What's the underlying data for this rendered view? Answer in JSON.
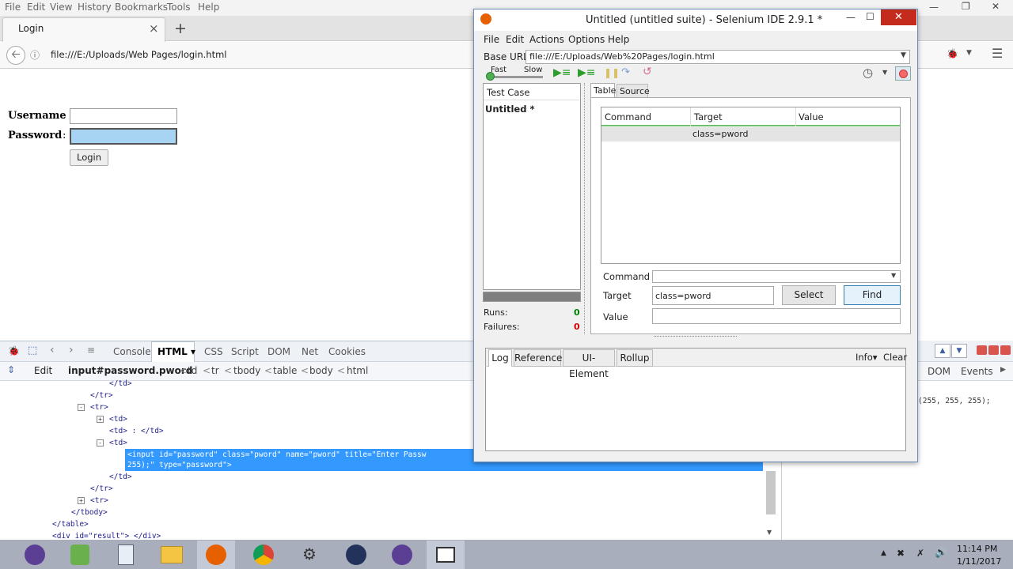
{
  "browser": {
    "menu": [
      "File",
      "Edit",
      "View",
      "History",
      "Bookmarks",
      "Tools",
      "Help"
    ],
    "tab_title": "Login",
    "tab_close": "×",
    "new_tab": "+",
    "url": "file:///E:/Uploads/Web Pages/login.html"
  },
  "page": {
    "username_label": "Username",
    "password_label": "Password",
    "colon": ":",
    "login_button": "Login"
  },
  "firebug": {
    "tabs": [
      "Console",
      "HTML ▾",
      "CSS",
      "Script",
      "DOM",
      "Net",
      "Cookies"
    ],
    "edit_label": "Edit",
    "breadcrumb_current": "input#password.pword",
    "breadcrumbs": [
      "td",
      "tr",
      "tbody",
      "table",
      "body",
      "html"
    ],
    "side_tabs": [
      "DOM",
      "Events"
    ],
    "side_style_text": "(255, 255, 255);",
    "code_lines": [
      "</td>",
      "</tr>",
      "<tr>",
      "<td>",
      "<td> : </td>",
      "<td>",
      "<input id=\"password\" class=\"pword\" name=\"pword\" title=\"Enter Passw",
      "255);\" type=\"password\">",
      "</td>",
      "</tr>",
      "<tr>",
      "</tbody>",
      "</table>",
      "<div id=\"result\"> </div>"
    ]
  },
  "selenium": {
    "window_title": "Untitled (untitled suite) - Selenium IDE 2.9.1 *",
    "menu": [
      "File",
      "Edit",
      "Actions",
      "Options",
      "Help"
    ],
    "base_url_label": "Base URL",
    "base_url": "file:///E:/Uploads/Web%20Pages/login.html",
    "speed_fast": "Fast",
    "speed_slow": "Slow",
    "test_case_header": "Test Case",
    "test_case_item": "Untitled *",
    "runs_label": "Runs:",
    "runs_value": "0",
    "failures_label": "Failures:",
    "failures_value": "0",
    "tabs": [
      "Table",
      "Source"
    ],
    "table_headers": [
      "Command",
      "Target",
      "Value"
    ],
    "table_rows": [
      {
        "command": "",
        "target": "class=pword",
        "value": ""
      }
    ],
    "command_label": "Command",
    "command_value": "",
    "target_label": "Target",
    "target_value": "class=pword",
    "value_label": "Value",
    "value_value": "",
    "select_button": "Select",
    "find_button": "Find",
    "bottom_tabs": [
      "Log",
      "Reference",
      "UI-Element",
      "Rollup"
    ],
    "info_button": "Info▾",
    "clear_button": "Clear"
  },
  "taskbar": {
    "time": "11:14 PM",
    "date": "1/11/2017"
  },
  "colors": {
    "selection_blue": "#3399ff",
    "password_focus": "#a8d4f4",
    "failure_red": "#d00000",
    "runs_green": "#008000"
  }
}
